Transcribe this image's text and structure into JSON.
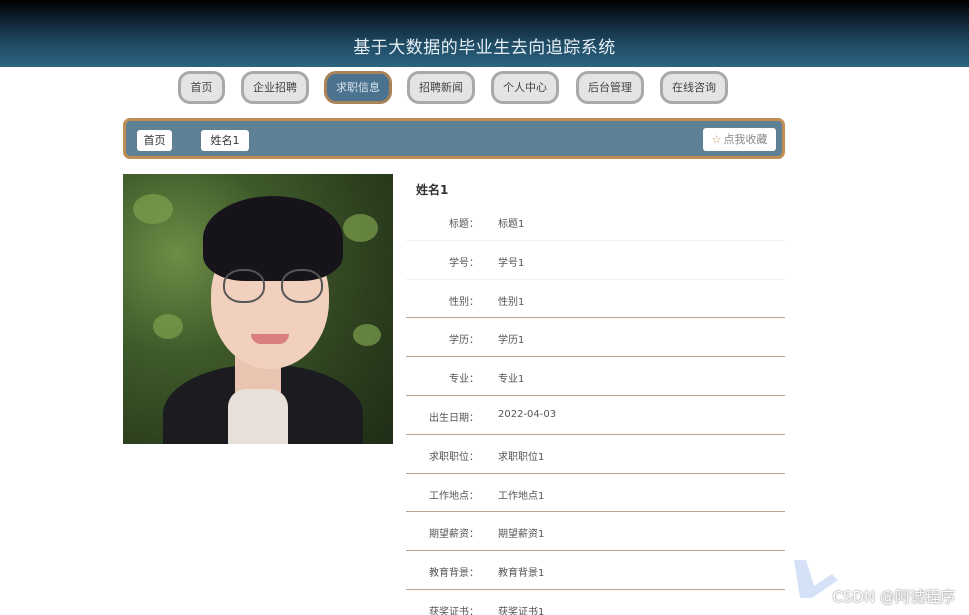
{
  "header": {
    "title": "基于大数据的毕业生去向追踪系统"
  },
  "nav": {
    "items": [
      {
        "label": "首页"
      },
      {
        "label": "企业招聘"
      },
      {
        "label": "求职信息"
      },
      {
        "label": "招聘新闻"
      },
      {
        "label": "个人中心"
      },
      {
        "label": "后台管理"
      },
      {
        "label": "在线咨询"
      }
    ],
    "active_index": 2
  },
  "breadcrumb": {
    "home": "首页",
    "current": "姓名1",
    "favorite_label": "点我收藏",
    "favorite_icon": "star-icon"
  },
  "detail": {
    "name": "姓名1",
    "fields": [
      {
        "label": "标题：",
        "value": "标题1"
      },
      {
        "label": "学号：",
        "value": "学号1"
      },
      {
        "label": "性别：",
        "value": "性别1"
      },
      {
        "label": "学历：",
        "value": "学历1"
      },
      {
        "label": "专业：",
        "value": "专业1"
      },
      {
        "label": "出生日期：",
        "value": "2022-04-03"
      },
      {
        "label": "求职职位：",
        "value": "求职职位1"
      },
      {
        "label": "工作地点：",
        "value": "工作地点1"
      },
      {
        "label": "期望薪资：",
        "value": "期望薪资1"
      },
      {
        "label": "教育背景：",
        "value": "教育背景1"
      },
      {
        "label": "获奖证书：",
        "value": "获奖证书1"
      }
    ]
  },
  "watermark": "CSDN @阿诚程序",
  "colors": {
    "header_dark": "#000000",
    "header_blue": "#2c6480",
    "nav_active": "#4b7390",
    "crumb_bar": "#5f8196",
    "crumb_border": "#c08d52"
  }
}
